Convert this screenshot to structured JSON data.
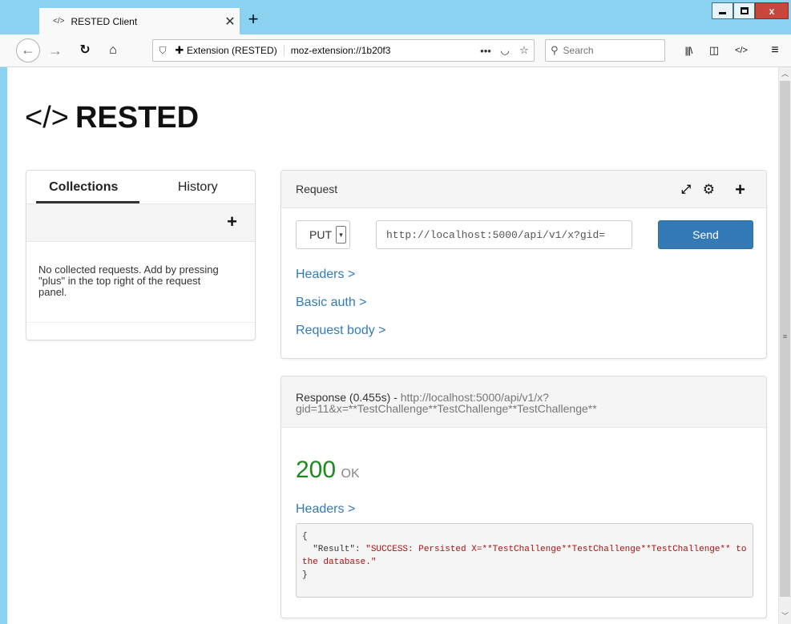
{
  "browser": {
    "tab_title": "RESTED Client",
    "tab_icon": "</>",
    "address_identity": "Extension (RESTED)",
    "address_url": "moz-extension://1b20f3",
    "search_placeholder": "Search"
  },
  "app": {
    "title": "RESTED"
  },
  "collections_panel": {
    "tabs": [
      "Collections",
      "History"
    ],
    "active_tab": "Collections",
    "empty_message": "No collected requests. Add by pressing \"plus\" in the top right of the request panel."
  },
  "request_panel": {
    "title": "Request",
    "method": "PUT",
    "url": "http://localhost:5000/api/v1/x?gid=",
    "send_label": "Send",
    "links": {
      "headers": "Headers >",
      "basic_auth": "Basic auth >",
      "request_body": "Request body >"
    }
  },
  "response_panel": {
    "title": "Response (0.455s) -",
    "url": "http://localhost:5000/api/v1/x?gid=11&x=**TestChallenge**TestChallenge**TestChallenge**",
    "status_code": "200",
    "status_text": "OK",
    "headers_link": "Headers >",
    "body": {
      "open": "{",
      "key": "\"Result\"",
      "value": "\"SUCCESS: Persisted X=**TestChallenge**TestChallenge**TestChallenge** to the database.\"",
      "close": "}"
    }
  },
  "colors": {
    "titlebar": "#8bd1f0",
    "send_button": "#337ab7",
    "link": "#337ab7",
    "status_ok": "#1c8a1c",
    "close_button": "#c9463d"
  }
}
